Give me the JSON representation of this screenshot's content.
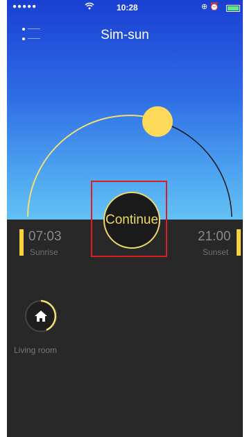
{
  "status_bar": {
    "signal": "●●●●●",
    "time": "10:28",
    "icons": "⊕ ⏰"
  },
  "header": {
    "title": "Sim-sun"
  },
  "sun_arc": {
    "continue_label": "Continue",
    "sunrise": {
      "time": "07:03",
      "label": "Sunrise"
    },
    "sunset": {
      "time": "21:00",
      "label": "Sunset"
    },
    "arc_color": "#f3df73",
    "sun_color": "#ffd95a"
  },
  "rooms": [
    {
      "label": "Living room",
      "icon": "home-icon"
    }
  ],
  "colors": {
    "accent": "#f7d23c",
    "background": "#282828",
    "highlight": "#e01b24"
  }
}
